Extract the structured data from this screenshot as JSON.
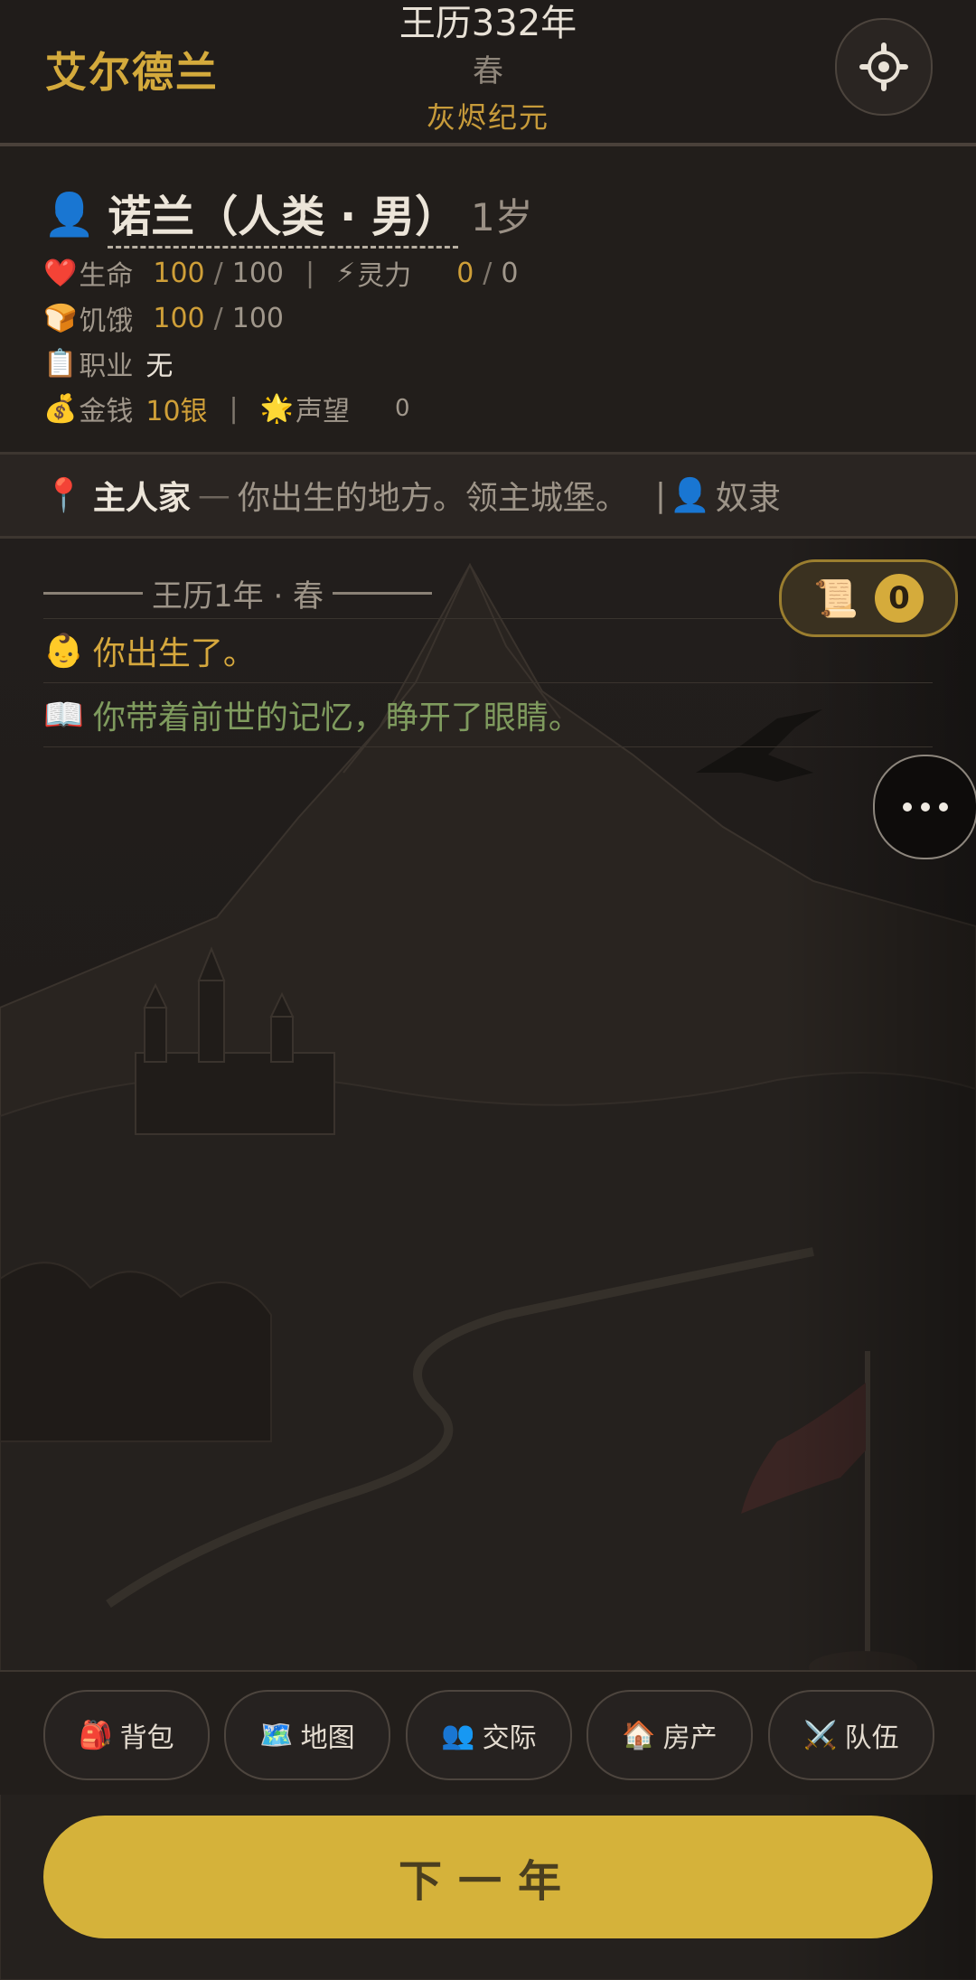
{
  "header": {
    "app_title": "艾尔德兰",
    "year": "王历332年",
    "season": "春",
    "era": "灰烬纪元"
  },
  "character": {
    "name": "诺兰（人类 · 男）",
    "age": "1岁",
    "stats": {
      "health": {
        "icon": "❤️",
        "label": "生命",
        "current": "100",
        "max": "100"
      },
      "spirit": {
        "icon": "⚡",
        "label": "灵力",
        "current": "0",
        "max": "0"
      },
      "hunger": {
        "icon": "🍞",
        "label": "饥饿",
        "current": "100",
        "max": "100"
      },
      "job": {
        "icon": "📋",
        "label": "职业",
        "value": "无"
      },
      "money": {
        "icon": "💰",
        "label": "金钱",
        "value": "10银"
      },
      "fame": {
        "icon": "🌟",
        "label": "声望",
        "value": "0"
      }
    }
  },
  "location": {
    "icon": "📍",
    "name": "主人家",
    "description": "你出生的地方。领主城堡。",
    "status_icon": "👤",
    "status": "奴隶"
  },
  "log": {
    "date_header": "王历1年 · 春",
    "entries": [
      {
        "icon": "👶",
        "text": "你出生了。",
        "color": "#d6a83d"
      },
      {
        "icon": "📖",
        "text": "你带着前世的记忆，睁开了眼睛。",
        "color": "#7f9b5e"
      }
    ]
  },
  "scroll_badge": {
    "icon": "📜",
    "count": "0"
  },
  "nav": [
    {
      "icon": "🎒",
      "label": "背包"
    },
    {
      "icon": "🗺️",
      "label": "地图"
    },
    {
      "icon": "👥",
      "label": "交际"
    },
    {
      "icon": "🏠",
      "label": "房产"
    },
    {
      "icon": "⚔️",
      "label": "队伍"
    }
  ],
  "next_year_label": "下一年",
  "colors": {
    "accent_gold": "#d5b23a",
    "background": "#211d1b"
  }
}
